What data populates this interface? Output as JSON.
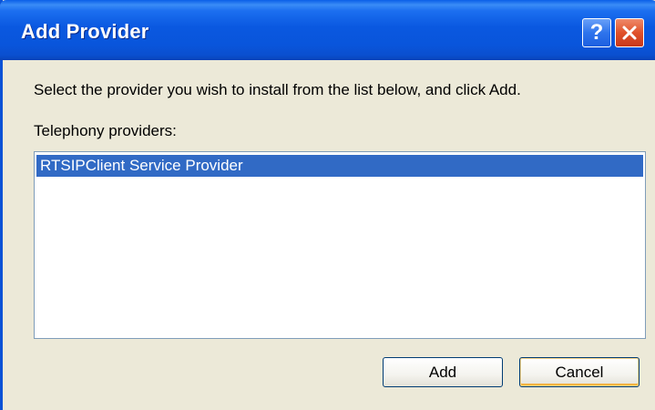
{
  "dialog": {
    "title": "Add Provider",
    "instruction": "Select the provider you wish to install from the list below, and click Add.",
    "list_label": "Telephony providers:",
    "providers": [
      {
        "label": "RTSIPClient Service Provider",
        "selected": true
      }
    ]
  },
  "titlebar": {
    "help_glyph": "?",
    "help_icon": "help-icon",
    "close_icon": "close-icon"
  },
  "buttons": {
    "add_label": "Add",
    "cancel_label": "Cancel"
  },
  "colors": {
    "titlebar": "#0a58e0",
    "face": "#ece9d8",
    "selection": "#316ac5",
    "close_button": "#e0512a"
  }
}
